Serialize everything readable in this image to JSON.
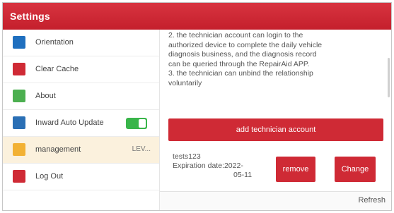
{
  "header": {
    "title": "Settings",
    "color": "#cf2a35"
  },
  "sidebar": {
    "items": [
      {
        "label": "Orientation",
        "icon": "orientation-icon",
        "color": "#1f6fbf"
      },
      {
        "label": "Clear Cache",
        "icon": "clear-cache-icon",
        "color": "#cf2a35"
      },
      {
        "label": "About",
        "icon": "about-icon",
        "color": "#4caf50"
      },
      {
        "label": "Inward Auto Update",
        "icon": "update-icon",
        "color": "#2a6fb5",
        "toggle": true
      },
      {
        "label": "management",
        "icon": "management-icon",
        "color": "#f2b134",
        "badge": "LEV..."
      },
      {
        "label": "Log Out",
        "icon": "logout-icon",
        "color": "#cf2a35"
      }
    ]
  },
  "content": {
    "description_lines": [
      "2. the technician account can login to the",
      "authorized device to complete the daily vehicle",
      "diagnosis business, and the diagnosis record",
      "can be queried through the RepairAid APP.",
      "3. the technician can unbind the relationship",
      "voluntarily"
    ],
    "add_button": "add technician account",
    "account": {
      "name": "tests123",
      "expiration_line1": "Expiration date:2022-",
      "expiration_line2": "05-11"
    },
    "remove_button": "remove",
    "change_button": "Change"
  },
  "footer": {
    "refresh": "Refresh"
  }
}
